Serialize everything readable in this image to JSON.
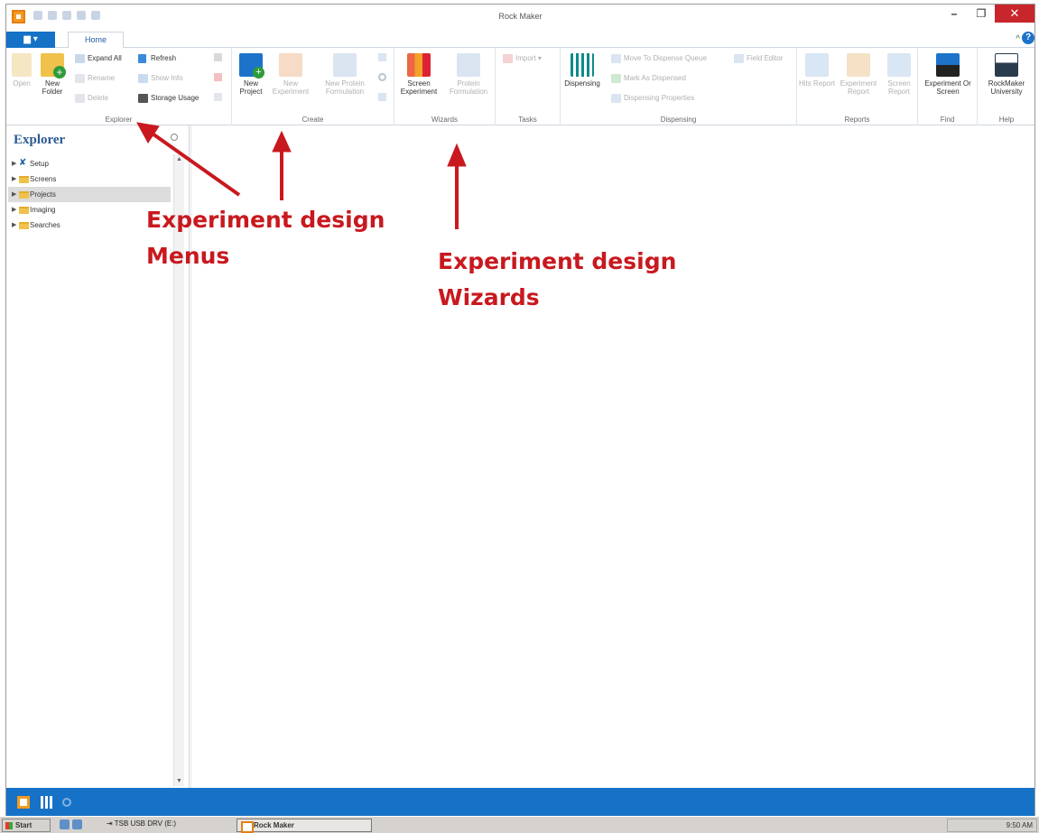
{
  "window": {
    "title": "Rock Maker",
    "minimize_symbol": "–",
    "restore_symbol": "❐",
    "close_symbol": "✕"
  },
  "ribbon_tabs": {
    "file_label": "▆ ▾",
    "home_label": "Home",
    "collapse_symbol": "^",
    "help_symbol": "?"
  },
  "ribbon": {
    "explorer_group": {
      "label": "Explorer",
      "open": "Open",
      "new_folder": "New Folder",
      "expand_all": "Expand All",
      "rename": "Rename",
      "delete": "Delete",
      "refresh": "Refresh",
      "show_info": "Show Info",
      "storage_usage": "Storage Usage"
    },
    "create_group": {
      "label": "Create",
      "new_project": "New Project",
      "new_experiment": "New Experiment",
      "new_protein_formulation": "New Protein Formulation"
    },
    "wizards_group": {
      "label": "Wizards",
      "screen_experiment": "Screen Experiment",
      "protein_formulation": "Protein Formulation"
    },
    "tasks_group": {
      "label": "Tasks",
      "import": "Import ▾"
    },
    "dispensing_group": {
      "label": "Dispensing",
      "dispensing": "Dispensing",
      "move_to_dispense_queue": "Move To Dispense Queue",
      "mark_as_dispensed": "Mark As Dispensed",
      "dispensing_properties": "Dispensing Properties",
      "field_editor": "Field Editor"
    },
    "reports_group": {
      "label": "Reports",
      "hits_report": "Hits Report",
      "experiment_report": "Experiment Report",
      "screen_report": "Screen Report"
    },
    "find_group": {
      "label": "Find",
      "experiment_or_screen": "Experiment Or Screen"
    },
    "help_group": {
      "label": "Help",
      "rockmaker_university": "RockMaker University"
    }
  },
  "explorer": {
    "title": "Explorer",
    "items": [
      {
        "label": "Setup",
        "icon": "tools-icon",
        "selected": false
      },
      {
        "label": "Screens",
        "icon": "folder-icon",
        "selected": false
      },
      {
        "label": "Projects",
        "icon": "folder-icon",
        "selected": true
      },
      {
        "label": "Imaging",
        "icon": "folder-icon",
        "selected": false
      },
      {
        "label": "Searches",
        "icon": "folder-icon",
        "selected": false
      }
    ]
  },
  "annotations": {
    "menus_line1": "Experiment design",
    "menus_line2": "Menus",
    "wizards_line1": "Experiment design",
    "wizards_line2": "Wizards"
  },
  "taskbar": {
    "start": "Start",
    "drive": "⇥ TSB USB DRV (E:)",
    "task_rock_maker": "Rock Maker",
    "clock": "9:50 AM"
  },
  "colors": {
    "accent": "#1572c7",
    "annotation_red": "#c8191f",
    "close_button": "#c8262c"
  }
}
